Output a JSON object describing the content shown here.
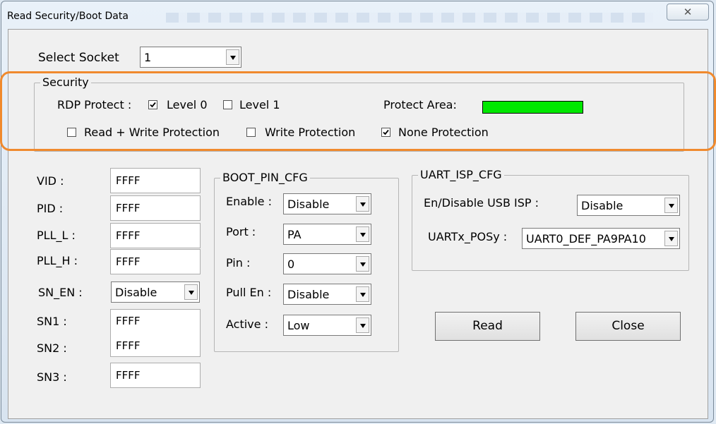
{
  "window": {
    "title": "Read Security/Boot Data",
    "close_glyph": "✕"
  },
  "socket": {
    "label": "Select Socket",
    "value": "1"
  },
  "security": {
    "group_title": "Security",
    "rdp_label": "RDP Protect :",
    "level0_label": "Level 0",
    "level0_checked": true,
    "level1_label": "Level 1",
    "level1_checked": false,
    "protect_area_label": "Protect Area:",
    "protect_area_color": "#00e800",
    "rw_label": "Read + Write Protection",
    "rw_checked": false,
    "w_label": "Write Protection",
    "w_checked": false,
    "none_label": "None Protection",
    "none_checked": true
  },
  "fields": {
    "vid_label": "VID :",
    "vid": "FFFF",
    "pid_label": "PID :",
    "pid": "FFFF",
    "pll_l_label": "PLL_L :",
    "pll_l": "FFFF",
    "pll_h_label": "PLL_H :",
    "pll_h": "FFFF",
    "sn_en_label": "SN_EN :",
    "sn_en": "Disable",
    "sn1_label": "SN1 :",
    "sn1": "FFFF",
    "sn2_label": "SN2 :",
    "sn2": "FFFF",
    "sn3_label": "SN3 :",
    "sn3": "FFFF"
  },
  "boot_pin": {
    "group_title": "BOOT_PIN_CFG",
    "enable_label": "Enable :",
    "enable": "Disable",
    "port_label": "Port :",
    "port": "PA",
    "pin_label": "Pin :",
    "pin": "0",
    "pull_label": "Pull En :",
    "pull": "Disable",
    "active_label": "Active :",
    "active": "Low"
  },
  "uart": {
    "group_title": "UART_ISP_CFG",
    "usb_label": "En/Disable USB ISP :",
    "usb": "Disable",
    "posy_label": "UARTx_POSy :",
    "posy": "UART0_DEF_PA9PA10"
  },
  "buttons": {
    "read": "Read",
    "close": "Close"
  },
  "annotation": {
    "highlight_color": "#f08a2e"
  }
}
